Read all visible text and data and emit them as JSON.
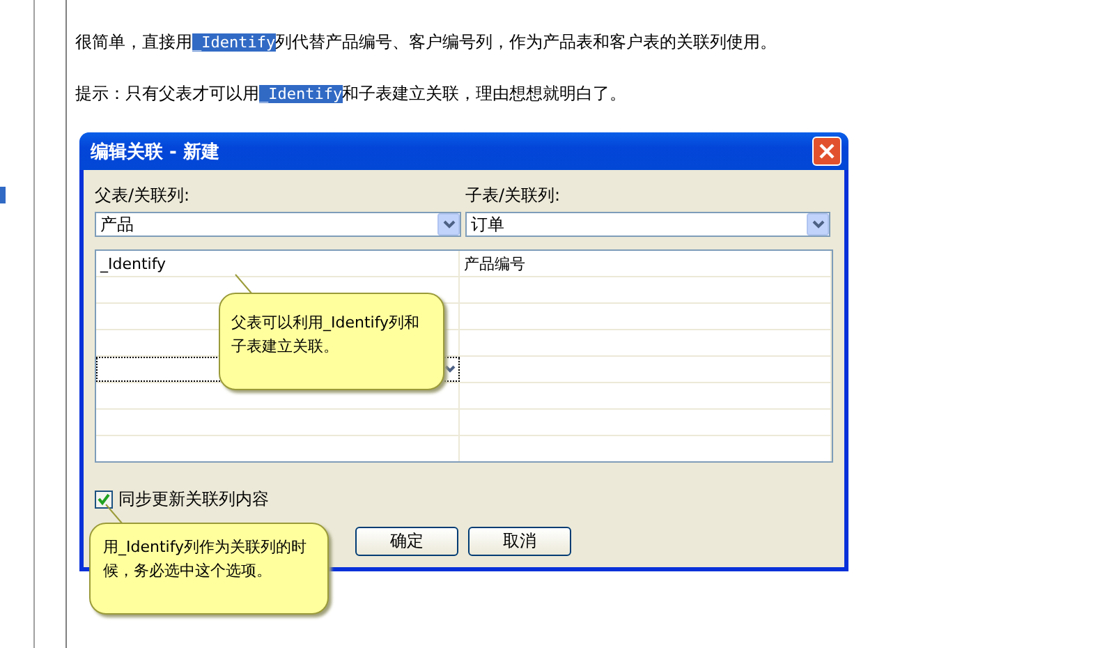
{
  "paragraphs": [
    {
      "segments": [
        {
          "text": "很简单，直接用",
          "highlighted": false
        },
        {
          "text": "_Identify",
          "highlighted": true
        },
        {
          "text": "列代替产品编号、客户编号列，作为产品表和客户表的关联列使用。",
          "highlighted": false
        }
      ]
    },
    {
      "segments": [
        {
          "text": "提示：只有父表才可以用",
          "highlighted": false
        },
        {
          "text": "_Identify",
          "highlighted": true
        },
        {
          "text": "和子表建立关联，理由想想就明白了。",
          "highlighted": false
        }
      ]
    }
  ],
  "dialog": {
    "title": "编辑关联 - 新建",
    "parent": {
      "label": "父表/关联列:",
      "value": "产品"
    },
    "child": {
      "label": "子表/关联列:",
      "value": "订单"
    },
    "rows": [
      {
        "parent_column": "_Identify",
        "child_column": "产品编号",
        "focused": false
      },
      {
        "parent_column": "",
        "child_column": "",
        "focused": false
      },
      {
        "parent_column": "",
        "child_column": "",
        "focused": false
      },
      {
        "parent_column": "",
        "child_column": "",
        "focused": false
      },
      {
        "parent_column": "",
        "child_column": "",
        "focused": true
      },
      {
        "parent_column": "",
        "child_column": "",
        "focused": false
      },
      {
        "parent_column": "",
        "child_column": "",
        "focused": false
      },
      {
        "parent_column": "",
        "child_column": "",
        "focused": false
      }
    ],
    "sync": {
      "label": "同步更新关联列内容",
      "checked": true
    },
    "buttons": [
      "确定",
      "取消"
    ]
  },
  "callouts": [
    "父表可以利用_Identify列和子表建立关联。",
    "用_Identify列作为关联列的时候，务必选中这个选项。"
  ]
}
